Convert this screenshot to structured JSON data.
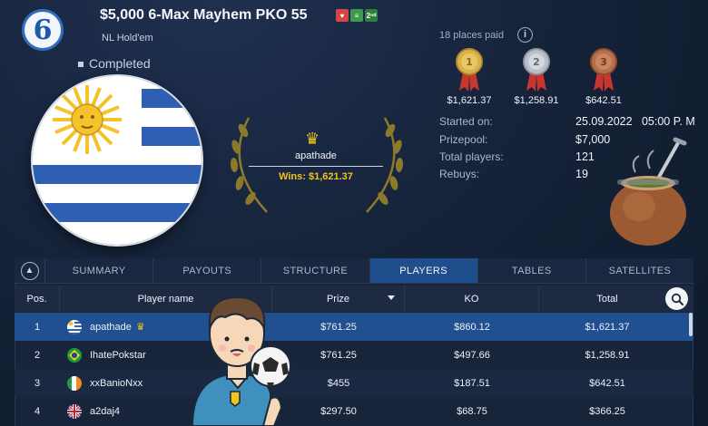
{
  "header": {
    "title": "$5,000 6-Max Mayhem PKO 55",
    "subtitle": "NL Hold'em",
    "status": "Completed",
    "badges": [
      "♥",
      "≡",
      "2ⁿᵈ"
    ]
  },
  "logo": {
    "glyph": "6"
  },
  "winner": {
    "crown": "♛",
    "name": "apathade",
    "wins": "Wins: $1,621.37"
  },
  "prizes": {
    "places_paid": "18 places paid",
    "info": "i",
    "medals": [
      {
        "rank": "1",
        "amount": "$1,621.37"
      },
      {
        "rank": "2",
        "amount": "$1,258.91"
      },
      {
        "rank": "3",
        "amount": "$642.51"
      }
    ]
  },
  "info": [
    {
      "label": "Started on:",
      "value": "25.09.2022   05:00 P. M"
    },
    {
      "label": "Prizepool:",
      "value": "$7,000"
    },
    {
      "label": "Total players:",
      "value": "121"
    },
    {
      "label": "Rebuys:",
      "value": "19"
    }
  ],
  "tabs": [
    "SUMMARY",
    "PAYOUTS",
    "STRUCTURE",
    "PLAYERS",
    "TABLES",
    "SATELLITES"
  ],
  "active_tab": "PLAYERS",
  "table": {
    "headers": {
      "pos": "Pos.",
      "name": "Player name",
      "prize": "Prize",
      "ko": "KO",
      "total": "Total"
    },
    "rows": [
      {
        "pos": "1",
        "name": "apathade",
        "prize": "$761.25",
        "ko": "$860.12",
        "total": "$1,621.37",
        "country": "uruguay"
      },
      {
        "pos": "2",
        "name": "IhatePokstar",
        "prize": "$761.25",
        "ko": "$497.66",
        "total": "$1,258.91",
        "country": "brazil"
      },
      {
        "pos": "3",
        "name": "xxBanioNxx",
        "prize": "$455",
        "ko": "$187.51",
        "total": "$642.51",
        "country": "ireland"
      },
      {
        "pos": "4",
        "name": "a2daj4",
        "prize": "$297.50",
        "ko": "$68.75",
        "total": "$366.25",
        "country": "uk"
      }
    ]
  },
  "colors": {
    "accent": "#1f4e8c",
    "gold": "#f3c320",
    "background": "#142136"
  }
}
